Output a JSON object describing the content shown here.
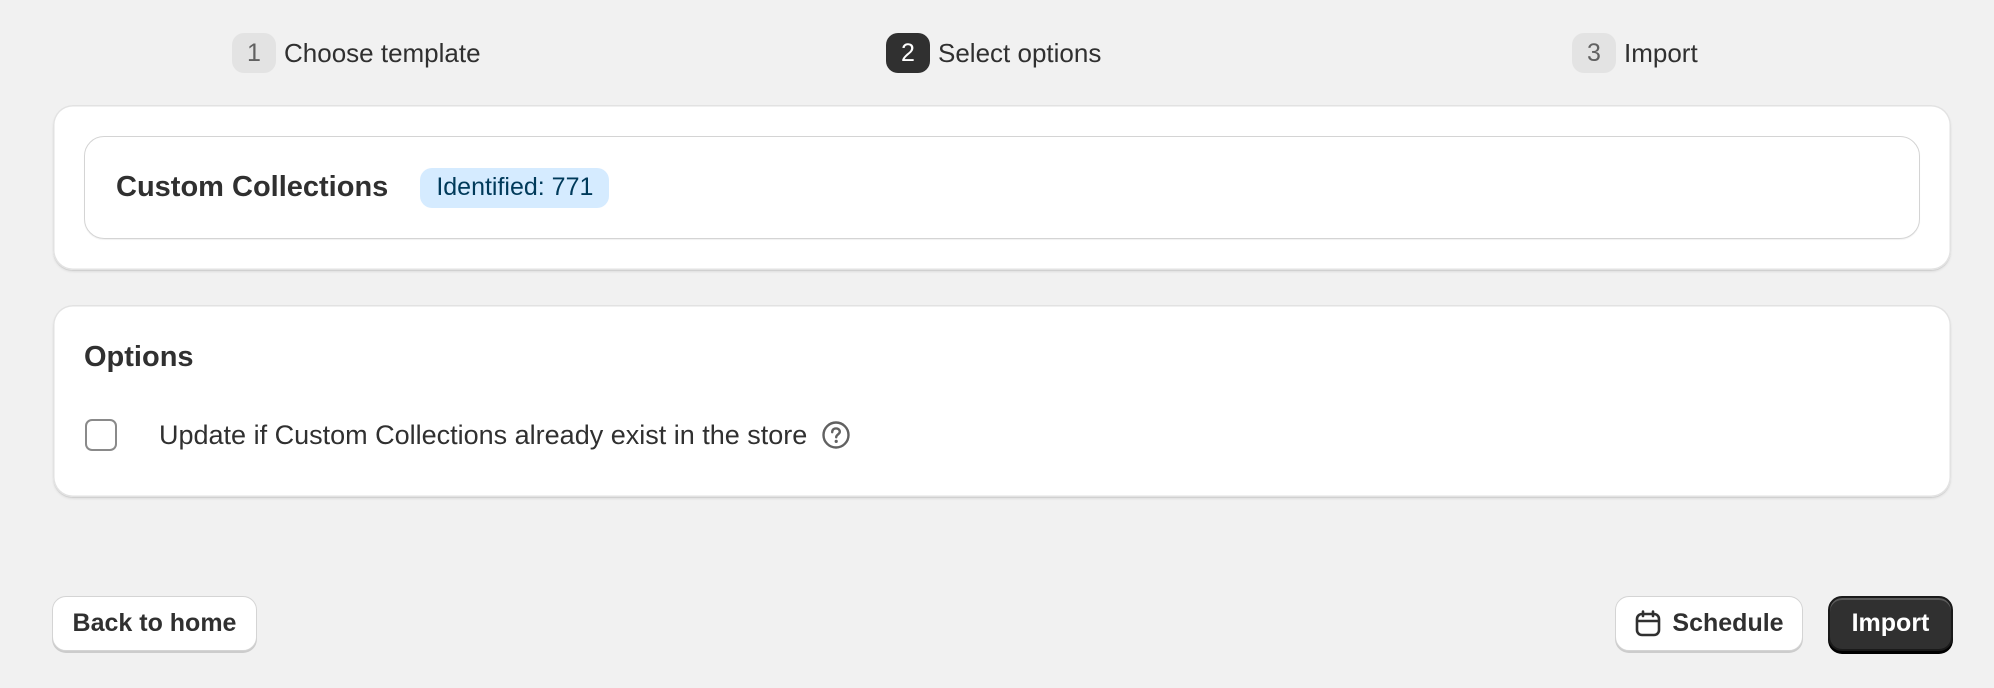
{
  "stepper": {
    "steps": [
      {
        "number": "1",
        "label": "Choose template"
      },
      {
        "number": "2",
        "label": "Select options"
      },
      {
        "number": "3",
        "label": "Import"
      }
    ],
    "active_step": 2
  },
  "collection_card": {
    "title": "Custom Collections",
    "badge": "Identified: 771"
  },
  "options_card": {
    "title": "Options",
    "option": {
      "label": "Update if Custom Collections already exist in the store",
      "checked": false,
      "help_icon": "question-circle-icon"
    }
  },
  "footer": {
    "back_label": "Back to home",
    "schedule_label": "Schedule",
    "schedule_icon": "calendar-icon",
    "import_label": "Import"
  },
  "colors": {
    "background": "#f1f1f1",
    "badge_bg": "#d5ebff",
    "primary_button": "#303030"
  }
}
